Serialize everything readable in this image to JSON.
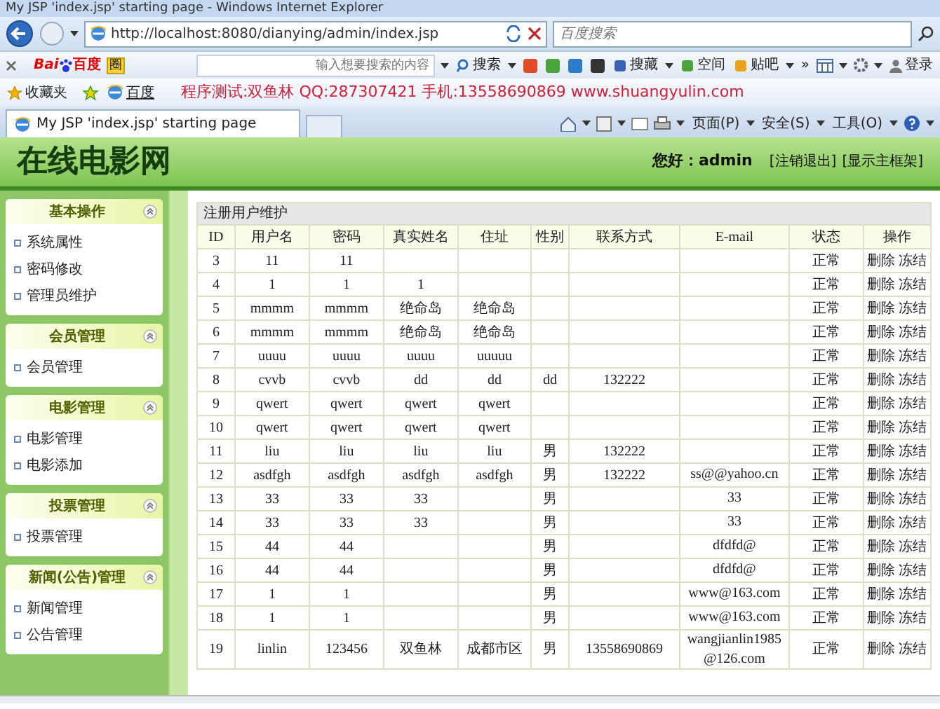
{
  "browser": {
    "title": "My JSP 'index.jsp' starting page - Windows Internet Explorer",
    "address": {
      "url": "http://localhost:8080/dianying/admin/index.jsp"
    },
    "search": {
      "placeholder": "百度搜索"
    },
    "baidu_toolbar": {
      "logo_left": "Bai",
      "logo_right": "百度",
      "badge": "圈",
      "placeholder": "输入想要搜索的内容",
      "search_button": "搜索",
      "buttons": [
        "搜藏",
        "空间",
        "贴吧"
      ],
      "more": "»",
      "login": "登录"
    },
    "favorites": {
      "label": "收藏夹",
      "links": [
        "百度"
      ],
      "notice": "程序测试:双鱼林 QQ:287307421 手机:13558690869 www.shuangyulin.com"
    },
    "tabs": [
      {
        "label": "My JSP 'index.jsp' starting page",
        "selected": true
      }
    ],
    "command_bar": [
      "页面(P)",
      "安全(S)",
      "工具(O)"
    ]
  },
  "header": {
    "site_title": "在线电影网",
    "greeting": "您好：admin",
    "links": [
      "[注销退出]",
      "[显示主框架]"
    ]
  },
  "sidebar": {
    "groups": [
      {
        "title": "基本操作",
        "expanded": true,
        "items": [
          "系统属性",
          "密码修改",
          "管理员维护"
        ]
      },
      {
        "title": "会员管理",
        "expanded": true,
        "items": [
          "会员管理"
        ]
      },
      {
        "title": "电影管理",
        "expanded": true,
        "items": [
          "电影管理",
          "电影添加"
        ]
      },
      {
        "title": "投票管理",
        "expanded": true,
        "items": [
          "投票管理"
        ]
      },
      {
        "title": "新闻(公告)管理",
        "expanded": true,
        "items": [
          "新闻管理",
          "公告管理"
        ]
      }
    ]
  },
  "table": {
    "caption": "注册用户维护",
    "columns": [
      "ID",
      "用户名",
      "密码",
      "真实姓名",
      "住址",
      "性别",
      "联系方式",
      "E-mail",
      "状态",
      "操作"
    ],
    "rows": [
      {
        "id": "3",
        "username": "11",
        "password": "11",
        "status": "正常",
        "actions": [
          "删除",
          "冻结"
        ]
      },
      {
        "id": "4",
        "username": "1",
        "password": "1",
        "real_name": "1",
        "status": "正常",
        "actions": [
          "删除",
          "冻结"
        ]
      },
      {
        "id": "5",
        "username": "mmmm",
        "password": "mmmm",
        "real_name": "绝命岛",
        "address": "绝命岛",
        "status": "正常",
        "actions": [
          "删除",
          "冻结"
        ]
      },
      {
        "id": "6",
        "username": "mmmm",
        "password": "mmmm",
        "real_name": "绝命岛",
        "address": "绝命岛",
        "status": "正常",
        "actions": [
          "删除",
          "冻结"
        ]
      },
      {
        "id": "7",
        "username": "uuuu",
        "password": "uuuu",
        "real_name": "uuuu",
        "address": "uuuuu",
        "status": "正常",
        "actions": [
          "删除",
          "冻结"
        ]
      },
      {
        "id": "8",
        "username": "cvvb",
        "password": "cvvb",
        "real_name": "dd",
        "address": "dd",
        "gender": "dd",
        "phone": "132222",
        "status": "正常",
        "actions": [
          "删除",
          "冻结"
        ]
      },
      {
        "id": "9",
        "username": "qwert",
        "password": "qwert",
        "real_name": "qwert",
        "address": "qwert",
        "status": "正常",
        "actions": [
          "删除",
          "冻结"
        ]
      },
      {
        "id": "10",
        "username": "qwert",
        "password": "qwert",
        "real_name": "qwert",
        "address": "qwert",
        "status": "正常",
        "actions": [
          "删除",
          "冻结"
        ]
      },
      {
        "id": "11",
        "username": "liu",
        "password": "liu",
        "real_name": "liu",
        "address": "liu",
        "gender": "男",
        "phone": "132222",
        "status": "正常",
        "actions": [
          "删除",
          "冻结"
        ]
      },
      {
        "id": "12",
        "username": "asdfgh",
        "password": "asdfgh",
        "real_name": "asdfgh",
        "address": "asdfgh",
        "gender": "男",
        "phone": "132222",
        "email": "ss@@yahoo.cn",
        "status": "正常",
        "actions": [
          "删除",
          "冻结"
        ]
      },
      {
        "id": "13",
        "username": "33",
        "password": "33",
        "real_name": "33",
        "gender": "男",
        "email": "33",
        "status": "正常",
        "actions": [
          "删除",
          "冻结"
        ]
      },
      {
        "id": "14",
        "username": "33",
        "password": "33",
        "real_name": "33",
        "gender": "男",
        "email": "33",
        "status": "正常",
        "actions": [
          "删除",
          "冻结"
        ]
      },
      {
        "id": "15",
        "username": "44",
        "password": "44",
        "gender": "男",
        "email": "dfdfd@",
        "status": "正常",
        "actions": [
          "删除",
          "冻结"
        ]
      },
      {
        "id": "16",
        "username": "44",
        "password": "44",
        "gender": "男",
        "email": "dfdfd@",
        "status": "正常",
        "actions": [
          "删除",
          "冻结"
        ]
      },
      {
        "id": "17",
        "username": "1",
        "password": "1",
        "gender": "男",
        "email": "www@163.com",
        "status": "正常",
        "actions": [
          "删除",
          "冻结"
        ]
      },
      {
        "id": "18",
        "username": "1",
        "password": "1",
        "gender": "男",
        "email": "www@163.com",
        "status": "正常",
        "actions": [
          "删除",
          "冻结"
        ]
      },
      {
        "id": "19",
        "username": "linlin",
        "password": "123456",
        "real_name": "双鱼林",
        "address": "成都市区",
        "gender": "男",
        "phone": "13558690869",
        "email": "wangjianlin1985@126.com",
        "status": "正常",
        "actions": [
          "删除",
          "冻结"
        ]
      }
    ]
  }
}
